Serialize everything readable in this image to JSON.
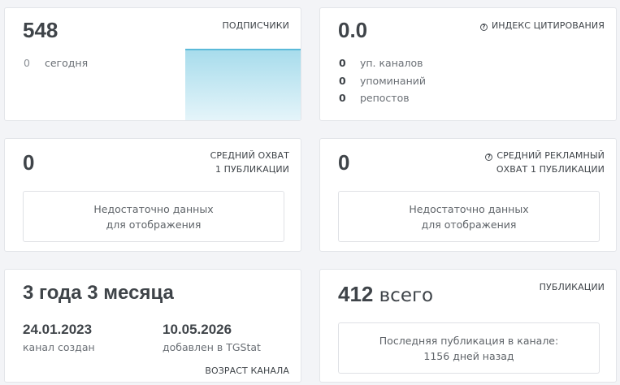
{
  "subscribers": {
    "value": "548",
    "label": "ПОДПИСЧИКИ",
    "today_count": "0",
    "today_label": "сегодня"
  },
  "citation": {
    "value": "0.0",
    "label": "ИНДЕКС ЦИТИРОВАНИЯ",
    "rows": [
      {
        "count": "0",
        "label": "уп. каналов"
      },
      {
        "count": "0",
        "label": "упоминаний"
      },
      {
        "count": "0",
        "label": "репостов"
      }
    ]
  },
  "avg_reach": {
    "value": "0",
    "label_line1": "СРЕДНИЙ ОХВАТ",
    "label_line2": "1 ПУБЛИКАЦИИ",
    "nodata_line1": "Недостаточно данных",
    "nodata_line2": "для отображения"
  },
  "avg_ad_reach": {
    "value": "0",
    "label_line1": "СРЕДНИЙ РЕКЛАМНЫЙ",
    "label_line2": "ОХВАТ 1 ПУБЛИКАЦИИ",
    "nodata_line1": "Недостаточно данных",
    "nodata_line2": "для отображения"
  },
  "channel_age": {
    "value": "3 года 3 месяца",
    "created_date": "24.01.2023",
    "created_label": "канал создан",
    "added_date": "10.05.2026",
    "added_label": "добавлен в TGStat",
    "label": "ВОЗРАСТ КАНАЛА"
  },
  "publications": {
    "value": "412",
    "suffix": "всего",
    "label": "ПУБЛИКАЦИИ",
    "last_line1": "Последняя публикация в канале:",
    "last_line2": "1156 дней назад"
  },
  "colors": {
    "accent": "#5bbad9"
  }
}
